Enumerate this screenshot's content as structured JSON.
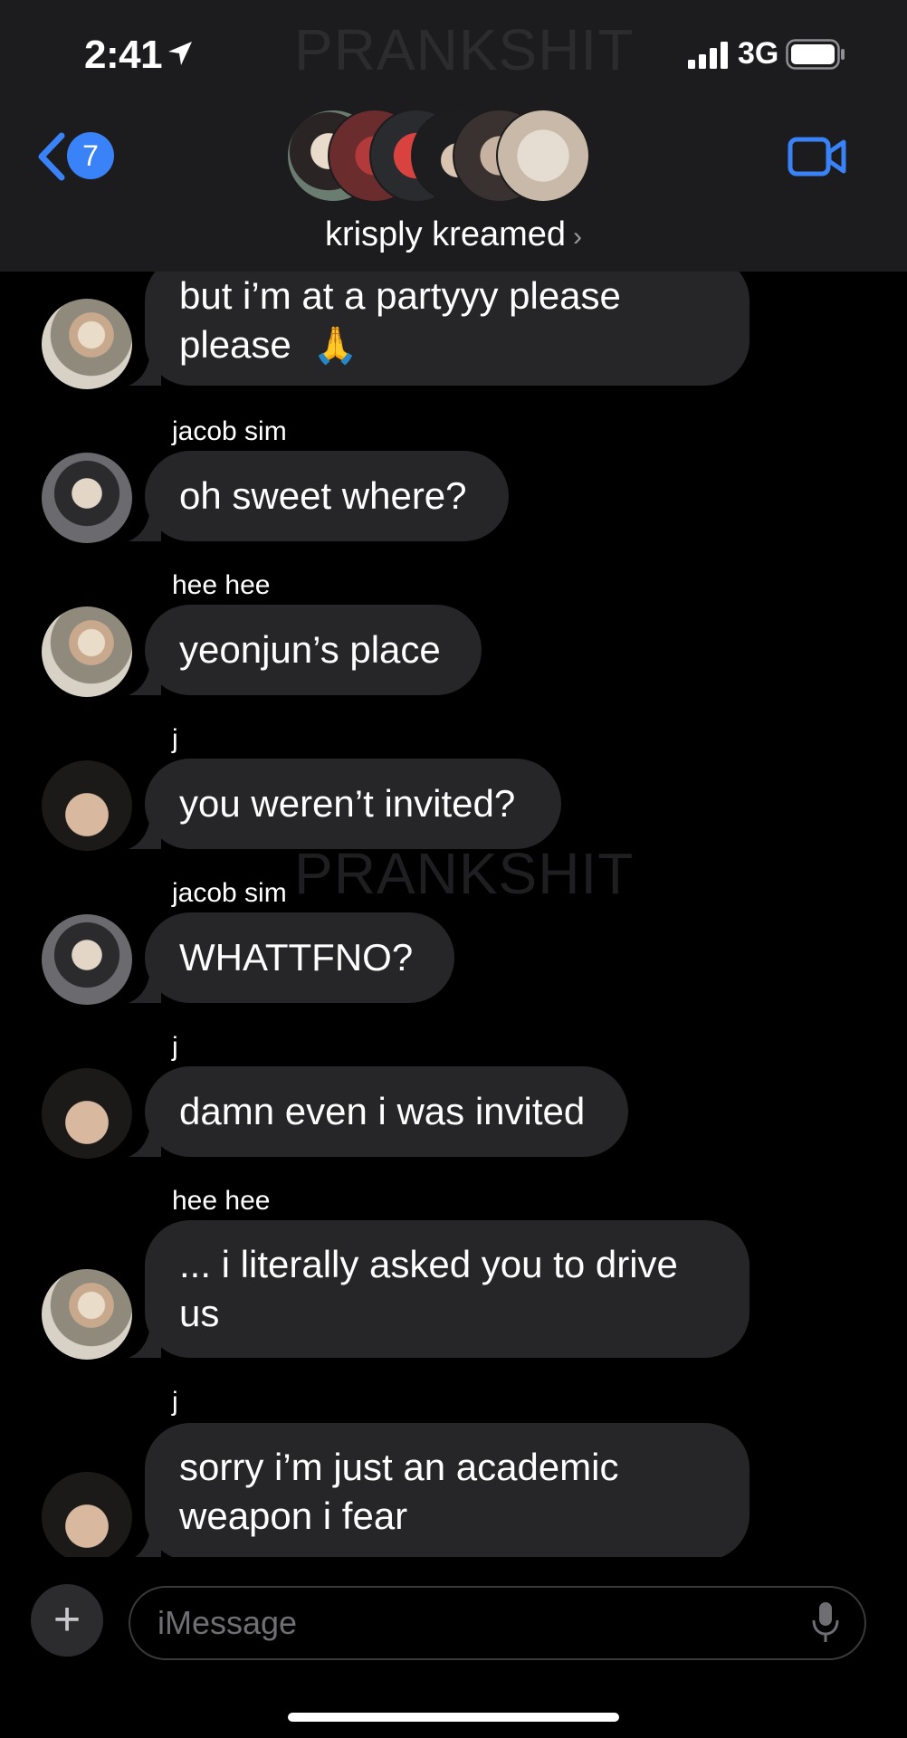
{
  "status_bar": {
    "time": "2:41",
    "network": "3G",
    "location_icon": "location-arrow-icon",
    "signal_icon": "signal-bars-icon",
    "battery_icon": "battery-icon"
  },
  "header": {
    "back_count": "7",
    "group_name": "krisply kreamed",
    "chevron": "›",
    "video_icon": "video-camera-icon",
    "accent_color": "#3a82f7"
  },
  "watermark": "PRANKSHIT",
  "messages": [
    {
      "sender": "",
      "text": "but i’m at a partyyy please please",
      "emoji": "🙏"
    },
    {
      "sender": "jacob sim",
      "text": "oh sweet where?"
    },
    {
      "sender": "hee hee",
      "text": "yeonjun’s place"
    },
    {
      "sender": "j",
      "text": "you weren’t invited?"
    },
    {
      "sender": "jacob sim",
      "text": "WHATTFNO?"
    },
    {
      "sender": "j",
      "text": "damn even i was invited"
    },
    {
      "sender": "hee hee",
      "text": "... i literally asked you to drive us"
    },
    {
      "sender": "j",
      "text": "sorry i’m just an academic weapon i fear"
    }
  ],
  "composer": {
    "placeholder": "iMessage",
    "value": "",
    "plus_label": "+",
    "mic_icon": "microphone-icon"
  },
  "colors": {
    "background": "#000000",
    "header_bg": "#1c1c1e",
    "bubble_bg": "#262628"
  }
}
